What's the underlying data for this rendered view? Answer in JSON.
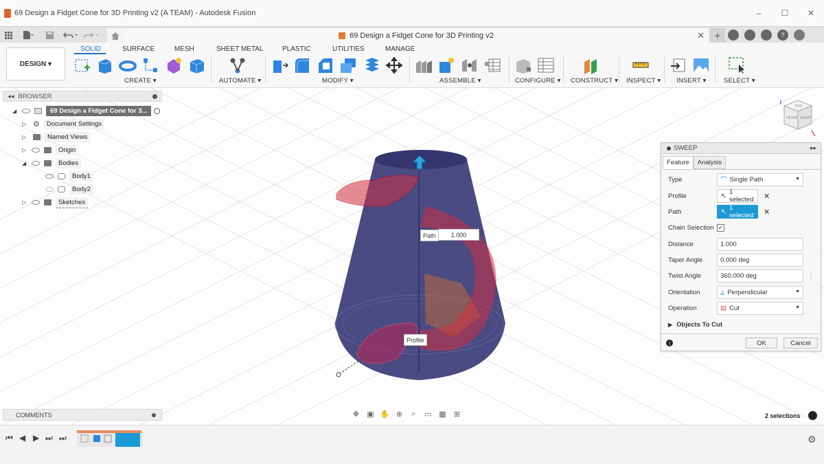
{
  "window": {
    "title": "69 Design a Fidget Cone for 3D Printing v2 (A TEAM) - Autodesk Fusion",
    "controls": [
      "–",
      "☐",
      "✕"
    ]
  },
  "doc_tab": {
    "title": "69 Design a Fidget Cone for 3D Printing v2",
    "close": "✕"
  },
  "ribbon": {
    "workspace": "DESIGN ▾",
    "tabs": [
      "SOLID",
      "SURFACE",
      "MESH",
      "SHEET METAL",
      "PLASTIC",
      "UTILITIES",
      "MANAGE"
    ],
    "groups": [
      "CREATE ▾",
      "AUTOMATE ▾",
      "MODIFY ▾",
      "ASSEMBLE ▾",
      "CONFIGURE ▾",
      "CONSTRUCT ▾",
      "INSPECT ▾",
      "INSERT ▾",
      "SELECT ▾"
    ]
  },
  "browser": {
    "title": "BROWSER",
    "root": "69 Design a Fidget Cone for 3...",
    "items": [
      "Document Settings",
      "Named Views",
      "Origin",
      "Bodies",
      "Body1",
      "Body2",
      "Sketches"
    ]
  },
  "viewport": {
    "path_label": "Path",
    "distance_input": "1.000",
    "profile_label": "Profile"
  },
  "sweep": {
    "title": "SWEEP",
    "tabs": [
      "Feature",
      "Analysis"
    ],
    "type_label": "Type",
    "type_value": "Single Path",
    "profile_label": "Profile",
    "profile_value": "1 selected",
    "path_label": "Path",
    "path_value": "1 selected",
    "chain_label": "Chain Selection",
    "chain_checked": "✓",
    "distance_label": "Distance",
    "distance_value": "1.000",
    "taper_label": "Taper Angle",
    "taper_value": "0.000 deg",
    "twist_label": "Twist Angle",
    "twist_value": "360.000 deg",
    "orientation_label": "Orientation",
    "orientation_value": "Perpendicular",
    "operation_label": "Operation",
    "operation_value": "Cut",
    "objects_label": "Objects To Cut",
    "ok": "OK",
    "cancel": "Cancel",
    "colors": {
      "selected": "#1c9ad6"
    }
  },
  "comments": {
    "title": "COMMENTS"
  },
  "status": {
    "selections": "2 selections"
  },
  "viewcube": {
    "front": "FRONT",
    "right": "RIGHT",
    "top": "TOP"
  }
}
